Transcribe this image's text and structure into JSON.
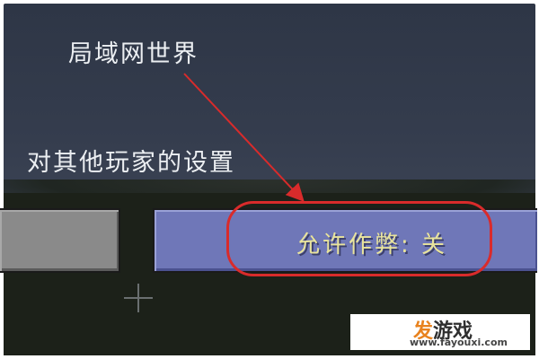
{
  "title": "局域网世界",
  "section_label": "对其他玩家的设置",
  "buttons": {
    "left_label": "",
    "cheat_label": "允许作弊: 关"
  },
  "watermark": {
    "logo_part1": "发",
    "logo_part2": "游戏",
    "url": "www.fayouxi.com"
  },
  "colors": {
    "annotation": "#d92b2b",
    "button_active": "#6f77b8",
    "button_disabled": "#8a8a8a",
    "button_text": "#e9e49c"
  },
  "icons": {
    "crosshair": "crosshair-icon",
    "arrow": "annotation-arrow"
  }
}
